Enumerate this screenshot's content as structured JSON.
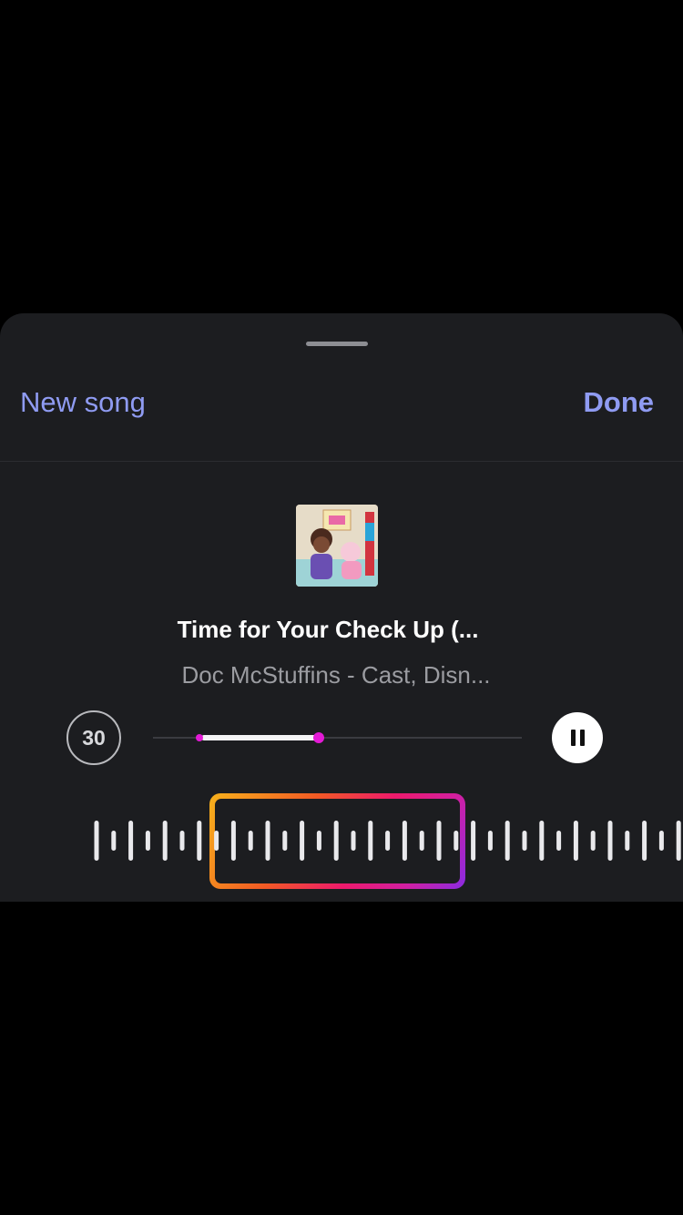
{
  "header": {
    "left_label": "New song",
    "right_label": "Done"
  },
  "song": {
    "title": "Time for Your Check Up (...",
    "artist": "Doc McStuffins - Cast, Disn...",
    "artwork": "album-artwork"
  },
  "player": {
    "duration_label": "30",
    "playback_state": "playing",
    "clip_start_fraction": 0.13,
    "clip_end_fraction": 0.45
  },
  "colors": {
    "accent": "#8f9bf2",
    "sheet_background": "#1c1d20",
    "progress_dot": "#e31ad6",
    "clip_gradient": [
      "#f7b21b",
      "#f25a24",
      "#ed1a6b",
      "#d21fa0",
      "#8a2be2"
    ]
  },
  "icons": {
    "pause": "pause-icon",
    "grabber": "sheet-grabber"
  }
}
